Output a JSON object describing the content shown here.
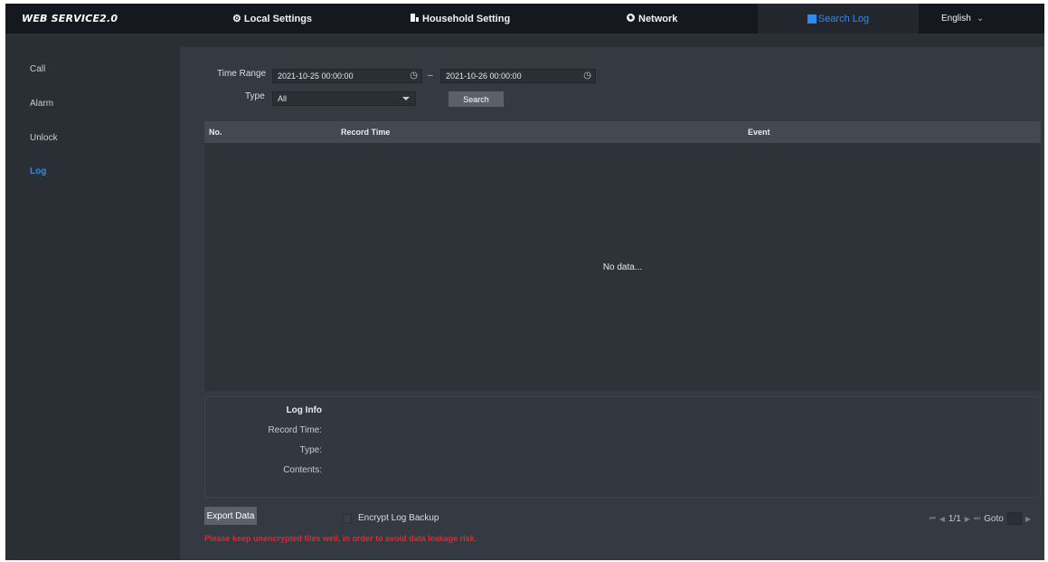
{
  "header": {
    "brand": "WEB SERVICE2.0",
    "nav": [
      {
        "label": "Local Settings",
        "icon": "gear-icon"
      },
      {
        "label": "Household Setting",
        "icon": "building-icon"
      },
      {
        "label": "Network",
        "icon": "globe-icon"
      },
      {
        "label": "Search Log",
        "icon": "search-log-icon",
        "active": true
      }
    ],
    "language": "English"
  },
  "sidebar": {
    "items": [
      {
        "label": "Call"
      },
      {
        "label": "Alarm"
      },
      {
        "label": "Unlock"
      },
      {
        "label": "Log",
        "active": true
      }
    ]
  },
  "filters": {
    "time_range_label": "Time Range",
    "start_time": "2021-10-25 00:00:00",
    "end_time": "2021-10-26 00:00:00",
    "separator": "–",
    "type_label": "Type",
    "type_value": "All",
    "search_label": "Search"
  },
  "table": {
    "columns": [
      "No.",
      "Record Time",
      "Event"
    ],
    "rows": [],
    "empty_text": "No data..."
  },
  "log_info": {
    "title": "Log Info",
    "record_time_label": "Record Time:",
    "type_label": "Type:",
    "contents_label": "Contents:"
  },
  "footer": {
    "export_label": "Export Data",
    "encrypt_label": "Encrypt Log Backup",
    "warning": "Please keep unencrypted files well, in order to avoid data leakage risk.",
    "page_indicator": "1/1",
    "goto_label": "Goto"
  },
  "colors": {
    "accent": "#2d8cf0",
    "warning": "#e5262c",
    "topbar": "#15181c",
    "panel": "#353942"
  }
}
